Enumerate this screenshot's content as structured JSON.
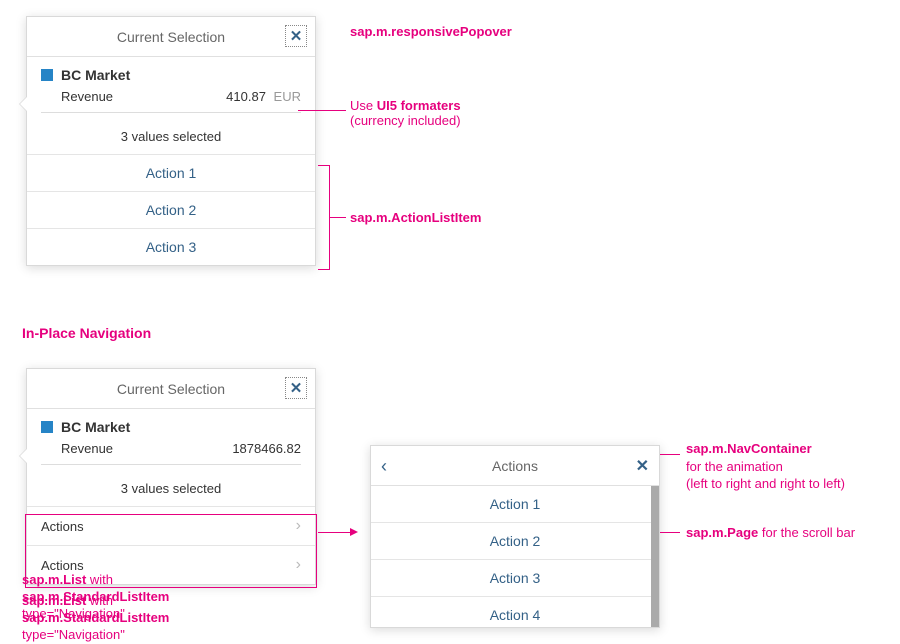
{
  "popover1": {
    "title": "Current Selection",
    "market": "BC Market",
    "revenue_label": "Revenue",
    "revenue_value": "410.87",
    "revenue_currency": "EUR",
    "values_selected": "3 values selected",
    "actions": [
      "Action 1",
      "Action 2",
      "Action 3"
    ]
  },
  "popover2": {
    "title": "Current Selection",
    "market": "BC Market",
    "revenue_label": "Revenue",
    "revenue_value": "1878466.82",
    "values_selected": "3 values selected",
    "nav_items": [
      "Actions",
      "Actions"
    ]
  },
  "actions_page": {
    "title": "Actions",
    "items": [
      "Action 1",
      "Action 2",
      "Action 3",
      "Action 4"
    ]
  },
  "annotations": {
    "responsivePopover": "sap.m.responsivePopover",
    "formatters_line1": "Use ",
    "formatters_bold": "UI5 formaters",
    "formatters_line2": "(currency included)",
    "actionListItem": "sap.m.ActionListItem",
    "inPlaceNavigation": "In-Place Navigation",
    "navContainer": "sap.m.NavContainer",
    "navContainer_sub1": "for the animation",
    "navContainer_sub2": "(left to right and right to left)",
    "page_scroll": "sap.m.Page",
    "page_scroll_suffix": " for the scroll bar",
    "list_line1_prefix": "sap.m.List",
    "list_line1_suffix": " with",
    "list_line2": "sap.m.StandardListItem",
    "list_line3": "type=\"Navigation\""
  }
}
